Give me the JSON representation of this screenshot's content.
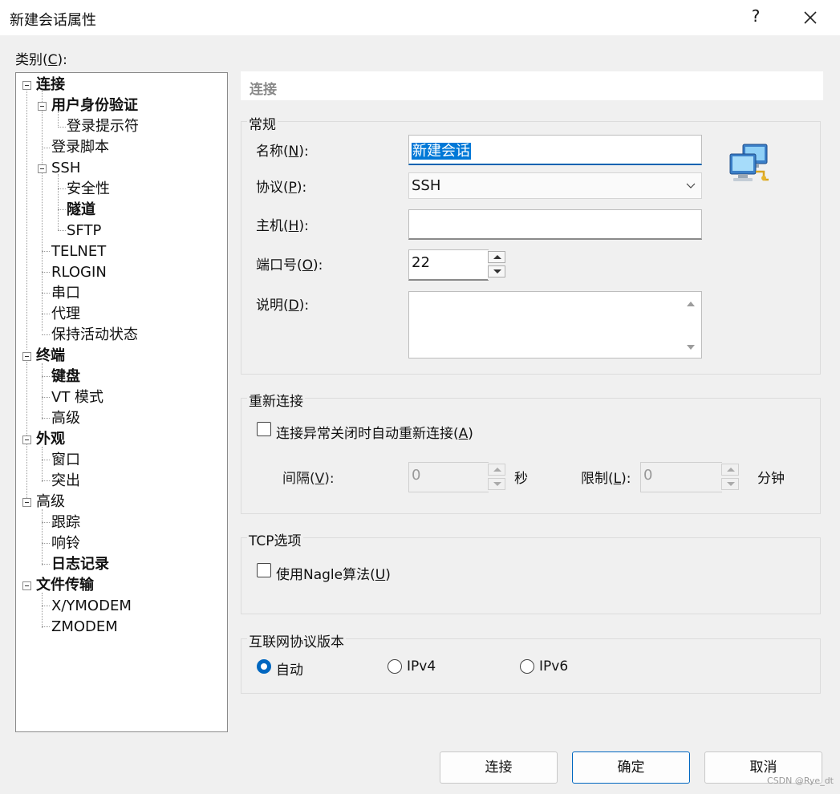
{
  "window": {
    "title": "新建会话属性",
    "help_glyph": "?"
  },
  "category": {
    "label_pre": "类别(",
    "label_key": "C",
    "label_post": "):"
  },
  "tree": [
    {
      "label": "连接"
    },
    {
      "label": "用户身份验证"
    },
    {
      "label": "登录提示符"
    },
    {
      "label": "登录脚本"
    },
    {
      "label": "SSH"
    },
    {
      "label": "安全性"
    },
    {
      "label": "隧道"
    },
    {
      "label": "SFTP"
    },
    {
      "label": "TELNET"
    },
    {
      "label": "RLOGIN"
    },
    {
      "label": "串口"
    },
    {
      "label": "代理"
    },
    {
      "label": "保持活动状态"
    },
    {
      "label": "终端"
    },
    {
      "label": "键盘"
    },
    {
      "label": "VT 模式"
    },
    {
      "label": "高级"
    },
    {
      "label": "外观"
    },
    {
      "label": "窗口"
    },
    {
      "label": "突出"
    },
    {
      "label": "高级"
    },
    {
      "label": "跟踪"
    },
    {
      "label": "响铃"
    },
    {
      "label": "日志记录"
    },
    {
      "label": "文件传输"
    },
    {
      "label": "X/YMODEM"
    },
    {
      "label": "ZMODEM"
    }
  ],
  "pane": {
    "header": "连接"
  },
  "general": {
    "group_label": "常规",
    "name_label_pre": "名称(",
    "name_label_key": "N",
    "name_label_post": "):",
    "name_value": "新建会话",
    "protocol_label_pre": "协议(",
    "protocol_label_key": "P",
    "protocol_label_post": "):",
    "protocol_value": "SSH",
    "host_label_pre": "主机(",
    "host_label_key": "H",
    "host_label_post": "):",
    "host_value": "",
    "port_label_pre": "端口号(",
    "port_label_key": "O",
    "port_label_post": "):",
    "port_value": "22",
    "desc_label_pre": "说明(",
    "desc_label_key": "D",
    "desc_label_post": "):",
    "desc_value": "",
    "icon": "network-computers-icon"
  },
  "reconnect": {
    "group_label": "重新连接",
    "checkbox_pre": "连接异常关闭时自动重新连接(",
    "checkbox_key": "A",
    "checkbox_post": ")",
    "checked": false,
    "interval_label_pre": "间隔(",
    "interval_label_key": "V",
    "interval_label_post": "):",
    "interval_value": "0",
    "interval_unit": "秒",
    "limit_label_pre": "限制(",
    "limit_label_key": "L",
    "limit_label_post": "):",
    "limit_value": "0",
    "limit_unit": "分钟"
  },
  "tcp": {
    "group_label": "TCP选项",
    "nagle_pre": "使用Nagle算法(",
    "nagle_key": "U",
    "nagle_post": ")",
    "checked": false
  },
  "ip_version": {
    "group_label": "互联网协议版本",
    "options": [
      "自动",
      "IPv4",
      "IPv6"
    ],
    "selected": "自动"
  },
  "buttons": {
    "connect": "连接",
    "ok": "确定",
    "cancel": "取消"
  },
  "watermark": "CSDN @Rye_dt",
  "colors": {
    "accent": "#0078d7",
    "window_bg": "#f0f0f0"
  }
}
